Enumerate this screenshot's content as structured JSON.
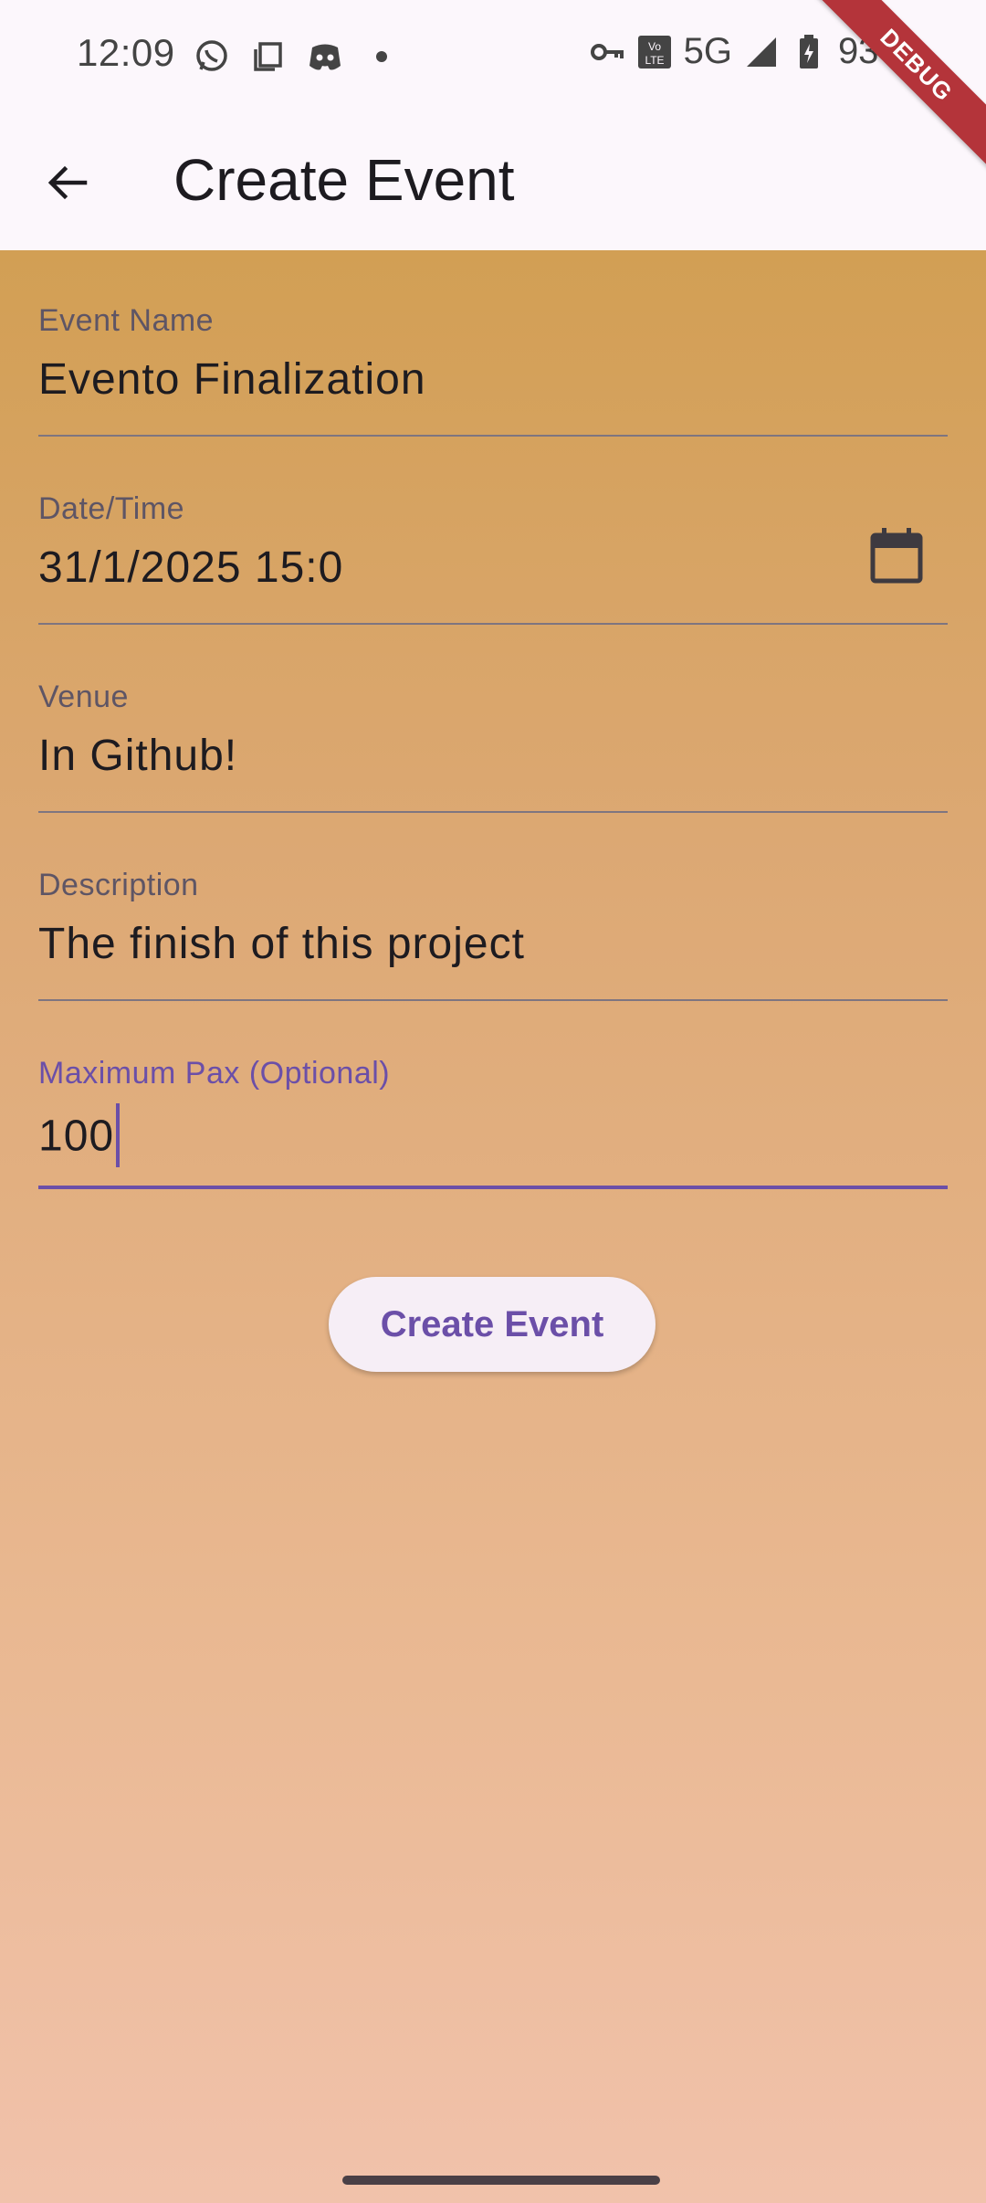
{
  "status_bar": {
    "time": "12:09",
    "network": "5G",
    "battery": "93%",
    "left_icons": [
      "whatsapp-icon",
      "copy-icon",
      "discord-icon",
      "dot-icon"
    ],
    "right_icons": [
      "vpn-key-icon",
      "volte-icon",
      "signal-icon",
      "battery-icon"
    ]
  },
  "debug_banner": "DEBUG",
  "app_bar": {
    "title": "Create Event",
    "back_icon": "arrow-back-icon"
  },
  "form": {
    "event_name": {
      "label": "Event Name",
      "value": "Evento Finalization"
    },
    "date_time": {
      "label": "Date/Time",
      "value": "31/1/2025 15:0",
      "icon": "calendar-icon"
    },
    "venue": {
      "label": "Venue",
      "value": "In Github!"
    },
    "description": {
      "label": "Description",
      "value": "The finish of this project"
    },
    "max_pax": {
      "label": "Maximum Pax (Optional)",
      "value": "100"
    }
  },
  "create_button": {
    "label": "Create Event"
  },
  "colors": {
    "accent": "#6B4FA8",
    "gradient_top": "#D29F54",
    "gradient_bottom": "#F1C2AB",
    "debug_banner": "#B4343A"
  }
}
